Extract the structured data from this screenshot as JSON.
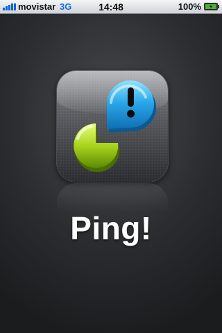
{
  "status_bar": {
    "carrier": "movistar",
    "network": "3G",
    "time": "14:48",
    "battery": "100%",
    "signal_icon": "signal-bars-icon",
    "battery_icon": "battery-charging-icon"
  },
  "splash": {
    "app_name": "Ping!",
    "app_icon": "ping-app-icon"
  },
  "colors": {
    "network": "#1a6fd6",
    "signal": "#0a64d8",
    "bubble_blue": "#2aa8ea",
    "bubble_green": "#a8d41c",
    "battery_fill": "#4caf2f"
  }
}
